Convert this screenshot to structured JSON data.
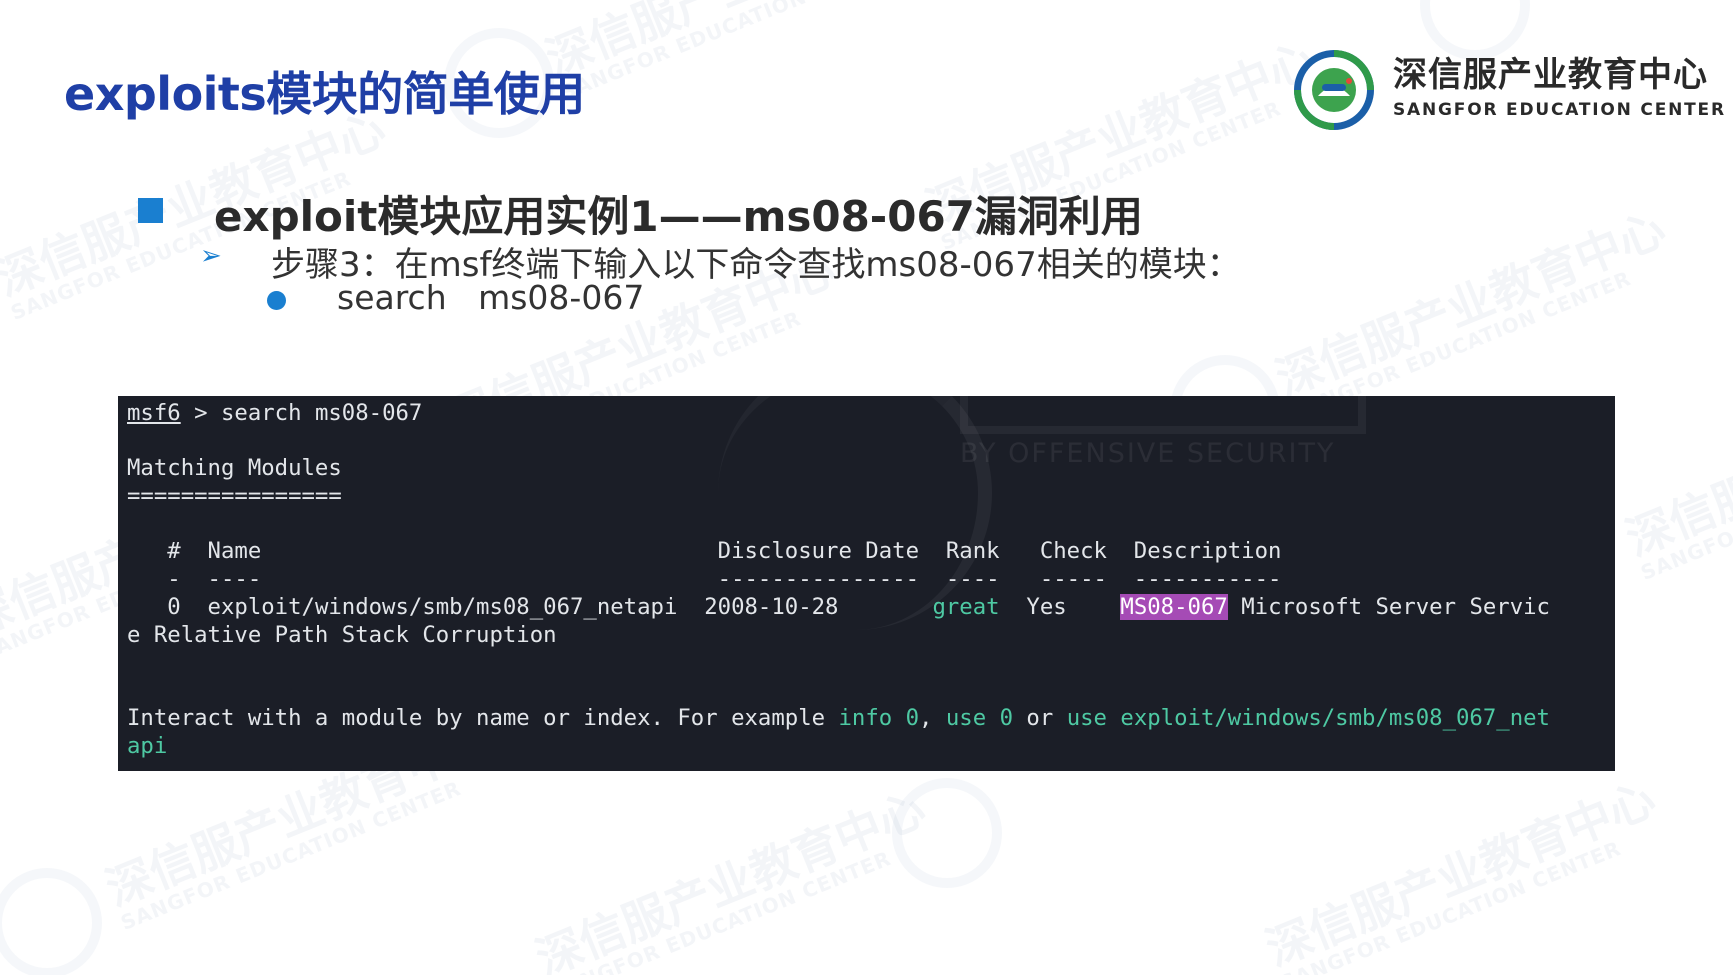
{
  "slide": {
    "title": "exploits模块的简单使用",
    "heading": "exploit模块应用实例1——ms08-067漏洞利用",
    "step": "步骤3：在msf终端下输入以下命令查找ms08-067相关的模块：",
    "command": "search   ms08-067"
  },
  "logo": {
    "name_zh": "深信服产业教育中心",
    "name_en": "SANGFOR EDUCATION CENTER",
    "badge_ring_text": "SANGFOR EDUCATION CENTER",
    "badge_inner_text": "深信服产业教育中心"
  },
  "watermark": {
    "zh": "深信服产业教育中心",
    "en": "SANGFOR EDUCATION CENTER"
  },
  "terminal": {
    "bg_text": "BY OFFENSIVE SECURITY",
    "prompt": "msf6",
    "prompt_sep": " > ",
    "typed_command": "search ms08-067",
    "section_title": "Matching Modules",
    "section_rule": "================",
    "header": "   #  Name                                  Disclosure Date  Rank   Check  Description",
    "header_rule": "   -  ----                                  ---------------  ----   -----  -----------",
    "row": {
      "index": "   0  ",
      "name": "exploit/windows/smb/ms08_067_netapi",
      "date": "  2008-10-28       ",
      "rank": "great",
      "check": "  Yes    ",
      "desc_tag": "MS08-067",
      "desc_rest": " Microsoft Server Servic",
      "desc_wrap": "e Relative Path Stack Corruption"
    },
    "hint": {
      "part1": "Interact with a module by name or index. For example ",
      "info_cmd": "info 0",
      "sep1": ", ",
      "use_cmd": "use 0",
      "sep2": " or ",
      "use_path_cmd": "use exploit/windows/smb/ms08_067_net",
      "wrap": "api"
    }
  }
}
